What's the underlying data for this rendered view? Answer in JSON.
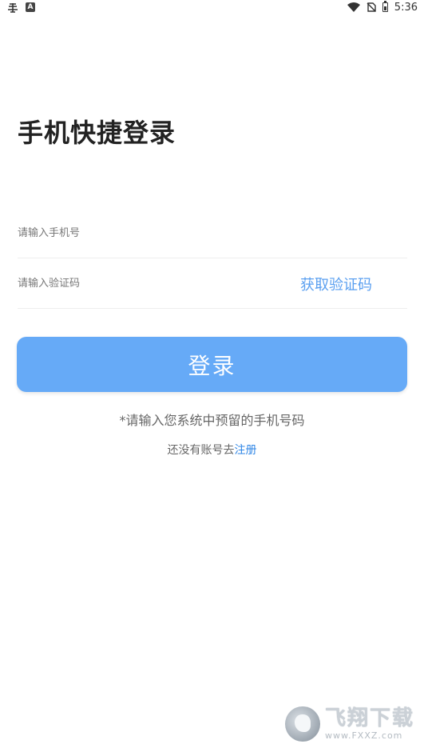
{
  "status_bar": {
    "left_icons": [
      "bug-icon",
      "text-a-icon"
    ],
    "right_icons": [
      "wifi-icon",
      "no-sim-icon",
      "battery-icon"
    ],
    "time": "5:36"
  },
  "login": {
    "title": "手机快捷登录",
    "phone_placeholder": "请输入手机号",
    "code_placeholder": "请输入验证码",
    "get_code_label": "获取验证码",
    "login_label": "登录",
    "hint": "*请输入您系统中预留的手机号码",
    "no_account_text": "还没有账号去",
    "register_label": "注册"
  },
  "colors": {
    "accent": "#5a9ff0",
    "button_bg": "#66aaf7",
    "link": "#2f86e6"
  }
}
